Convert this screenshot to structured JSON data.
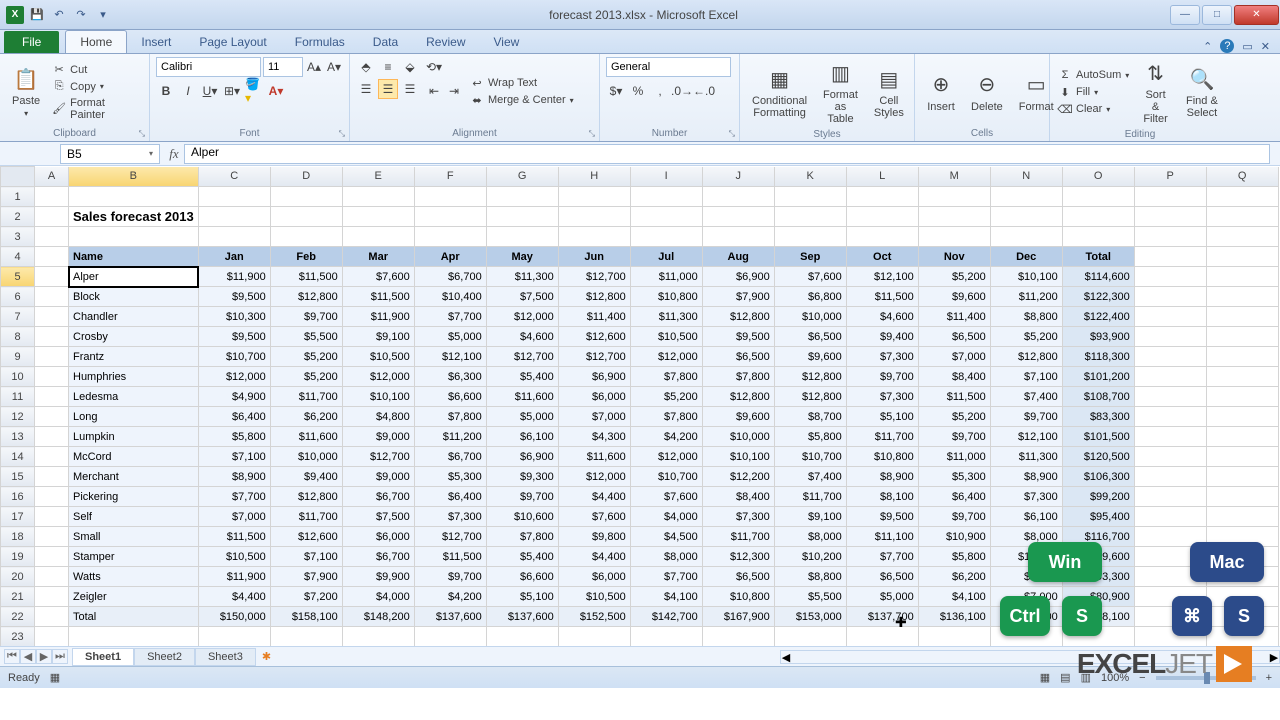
{
  "window": {
    "title": "forecast 2013.xlsx - Microsoft Excel"
  },
  "tabs": {
    "file": "File",
    "list": [
      "Home",
      "Insert",
      "Page Layout",
      "Formulas",
      "Data",
      "Review",
      "View"
    ],
    "active": "Home"
  },
  "clipboard": {
    "paste": "Paste",
    "cut": "Cut",
    "copy": "Copy",
    "painter": "Format Painter",
    "group": "Clipboard"
  },
  "font": {
    "name": "Calibri",
    "size": "11",
    "group": "Font"
  },
  "alignment": {
    "wrap": "Wrap Text",
    "merge": "Merge & Center",
    "group": "Alignment"
  },
  "number": {
    "format": "General",
    "group": "Number"
  },
  "styles": {
    "cond": "Conditional Formatting",
    "table": "Format as Table",
    "cell": "Cell Styles",
    "group": "Styles"
  },
  "cells": {
    "insert": "Insert",
    "delete": "Delete",
    "format": "Format",
    "group": "Cells"
  },
  "editing": {
    "autosum": "AutoSum",
    "fill": "Fill",
    "clear": "Clear",
    "sort": "Sort & Filter",
    "find": "Find & Select",
    "group": "Editing"
  },
  "namebox": "B5",
  "formula": "Alper",
  "columns": [
    "A",
    "B",
    "C",
    "D",
    "E",
    "F",
    "G",
    "H",
    "I",
    "J",
    "K",
    "L",
    "M",
    "N",
    "O",
    "P",
    "Q"
  ],
  "sheet_title": "Sales forecast 2013",
  "headers": [
    "Name",
    "Jan",
    "Feb",
    "Mar",
    "Apr",
    "May",
    "Jun",
    "Jul",
    "Aug",
    "Sep",
    "Oct",
    "Nov",
    "Dec",
    "Total"
  ],
  "rows": [
    {
      "name": "Alper",
      "v": [
        "$11,900",
        "$11,500",
        "$7,600",
        "$6,700",
        "$11,300",
        "$12,700",
        "$11,000",
        "$6,900",
        "$7,600",
        "$12,100",
        "$5,200",
        "$10,100",
        "$114,600"
      ]
    },
    {
      "name": "Block",
      "v": [
        "$9,500",
        "$12,800",
        "$11,500",
        "$10,400",
        "$7,500",
        "$12,800",
        "$10,800",
        "$7,900",
        "$6,800",
        "$11,500",
        "$9,600",
        "$11,200",
        "$122,300"
      ]
    },
    {
      "name": "Chandler",
      "v": [
        "$10,300",
        "$9,700",
        "$11,900",
        "$7,700",
        "$12,000",
        "$11,400",
        "$11,300",
        "$12,800",
        "$10,000",
        "$4,600",
        "$11,400",
        "$8,800",
        "$122,400"
      ]
    },
    {
      "name": "Crosby",
      "v": [
        "$9,500",
        "$5,500",
        "$9,100",
        "$5,000",
        "$4,600",
        "$12,600",
        "$10,500",
        "$9,500",
        "$6,500",
        "$9,400",
        "$6,500",
        "$5,200",
        "$93,900"
      ]
    },
    {
      "name": "Frantz",
      "v": [
        "$10,700",
        "$5,200",
        "$10,500",
        "$12,100",
        "$12,700",
        "$12,700",
        "$12,000",
        "$6,500",
        "$9,600",
        "$7,300",
        "$7,000",
        "$12,800",
        "$118,300"
      ]
    },
    {
      "name": "Humphries",
      "v": [
        "$12,000",
        "$5,200",
        "$12,000",
        "$6,300",
        "$5,400",
        "$6,900",
        "$7,800",
        "$7,800",
        "$12,800",
        "$9,700",
        "$8,400",
        "$7,100",
        "$101,200"
      ]
    },
    {
      "name": "Ledesma",
      "v": [
        "$4,900",
        "$11,700",
        "$10,100",
        "$6,600",
        "$11,600",
        "$6,000",
        "$5,200",
        "$12,800",
        "$12,800",
        "$7,300",
        "$11,500",
        "$7,400",
        "$108,700"
      ]
    },
    {
      "name": "Long",
      "v": [
        "$6,400",
        "$6,200",
        "$4,800",
        "$7,800",
        "$5,000",
        "$7,000",
        "$7,800",
        "$9,600",
        "$8,700",
        "$5,100",
        "$5,200",
        "$9,700",
        "$83,300"
      ]
    },
    {
      "name": "Lumpkin",
      "v": [
        "$5,800",
        "$11,600",
        "$9,000",
        "$11,200",
        "$6,100",
        "$4,300",
        "$4,200",
        "$10,000",
        "$5,800",
        "$11,700",
        "$9,700",
        "$12,100",
        "$101,500"
      ]
    },
    {
      "name": "McCord",
      "v": [
        "$7,100",
        "$10,000",
        "$12,700",
        "$6,700",
        "$6,900",
        "$11,600",
        "$12,000",
        "$10,100",
        "$10,700",
        "$10,800",
        "$11,000",
        "$11,300",
        "$120,500"
      ]
    },
    {
      "name": "Merchant",
      "v": [
        "$8,900",
        "$9,400",
        "$9,000",
        "$5,300",
        "$9,300",
        "$12,000",
        "$10,700",
        "$12,200",
        "$7,400",
        "$8,900",
        "$5,300",
        "$8,900",
        "$106,300"
      ]
    },
    {
      "name": "Pickering",
      "v": [
        "$7,700",
        "$12,800",
        "$6,700",
        "$6,400",
        "$9,700",
        "$4,400",
        "$7,600",
        "$8,400",
        "$11,700",
        "$8,100",
        "$6,400",
        "$7,300",
        "$99,200"
      ]
    },
    {
      "name": "Self",
      "v": [
        "$7,000",
        "$11,700",
        "$7,500",
        "$7,300",
        "$10,600",
        "$7,600",
        "$4,000",
        "$7,300",
        "$9,100",
        "$9,500",
        "$9,700",
        "$6,100",
        "$95,400"
      ]
    },
    {
      "name": "Small",
      "v": [
        "$11,500",
        "$12,600",
        "$6,000",
        "$12,700",
        "$7,800",
        "$9,800",
        "$4,500",
        "$11,700",
        "$8,000",
        "$11,100",
        "$10,900",
        "$8,000",
        "$116,700"
      ]
    },
    {
      "name": "Stamper",
      "v": [
        "$10,500",
        "$7,100",
        "$6,700",
        "$11,500",
        "$5,400",
        "$4,400",
        "$8,000",
        "$12,300",
        "$10,200",
        "$7,700",
        "$5,800",
        "$10,000",
        "$99,600"
      ]
    },
    {
      "name": "Watts",
      "v": [
        "$11,900",
        "$7,900",
        "$9,900",
        "$9,700",
        "$6,600",
        "$6,000",
        "$7,700",
        "$6,500",
        "$8,800",
        "$6,500",
        "$6,200",
        "$9,600",
        "$93,300"
      ]
    },
    {
      "name": "Zeigler",
      "v": [
        "$4,400",
        "$7,200",
        "$4,000",
        "$4,200",
        "$5,100",
        "$10,500",
        "$4,100",
        "$10,800",
        "$5,500",
        "$5,000",
        "$4,100",
        "$7,000",
        "$80,900"
      ]
    }
  ],
  "total_row": {
    "name": "Total",
    "v": [
      "$150,000",
      "$158,100",
      "$148,200",
      "$137,600",
      "$137,600",
      "$152,500",
      "$142,700",
      "$167,900",
      "$153,000",
      "$137,700",
      "$136,100",
      "$154,600",
      "$1,778,100"
    ]
  },
  "sheets": [
    "Sheet1",
    "Sheet2",
    "Sheet3"
  ],
  "status": {
    "ready": "Ready",
    "zoom": "100%"
  },
  "badges": {
    "win": "Win",
    "mac": "Mac",
    "ctrl": "Ctrl",
    "s": "S",
    "cmd": "⌘",
    "s2": "S"
  },
  "logo": "EXCEL"
}
